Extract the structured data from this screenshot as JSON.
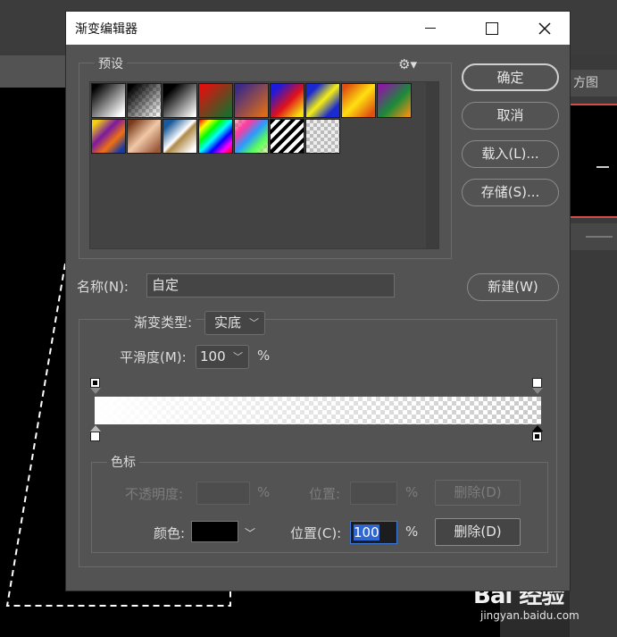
{
  "background": {
    "right_panel_tab": "方图",
    "watermark_logo": "Bai 经验",
    "watermark_url": "jingyan.baidu.com"
  },
  "dialog": {
    "title": "渐变编辑器",
    "presets": {
      "label": "预设",
      "swatches": [
        {
          "name": "black-white",
          "style": "linear-gradient(135deg,#000 10%,#fff 90%)"
        },
        {
          "name": "black-transparent",
          "style": "linear-gradient(135deg,#000 10%,rgba(0,0,0,0) 90%)",
          "checker": true
        },
        {
          "name": "black-white-2",
          "style": "linear-gradient(135deg,#000 20%,#fff 95%)"
        },
        {
          "name": "red-green",
          "style": "linear-gradient(135deg,#e01010 10%,#1b6d2a 90%)"
        },
        {
          "name": "violet-orange",
          "style": "linear-gradient(135deg,#3a2a8a 10%,#d96a1a 90%)"
        },
        {
          "name": "blue-red-yellow",
          "style": "linear-gradient(135deg,#1a1ae0 15%,#e0101a 55%,#f5e010 90%)"
        },
        {
          "name": "blue-yellow-blue",
          "style": "linear-gradient(135deg,#1a2ad0 20%,#f5f010 50%,#1a2ad0 80%)"
        },
        {
          "name": "orange-yellow-orange",
          "style": "linear-gradient(135deg,#e05010 10%,#ffe010 50%,#e05010 90%)"
        },
        {
          "name": "violet-green-orange",
          "style": "linear-gradient(135deg,#8a1aa0 10%,#1a8a3a 55%,#f09010 95%)"
        },
        {
          "name": "yellow-violet-orange-blue",
          "style": "linear-gradient(135deg,#f5d010 10%,#7a1aa0 40%,#f07010 65%,#1a3aa0 90%)"
        },
        {
          "name": "copper",
          "style": "linear-gradient(135deg,#7a3a1a 10%,#f0c8a8 50%,#9a5a3a 90%)"
        },
        {
          "name": "chrome",
          "style": "linear-gradient(135deg,#1a5a9a 15%,#ffffff 48%,#b08a4a 55%,#ffffff 90%)"
        },
        {
          "name": "spectrum",
          "style": "linear-gradient(135deg,#ff0000,#ffff00,#00ff00,#00ffff,#0000ff,#ff00ff,#ff0000)"
        },
        {
          "name": "transparent-rainbow",
          "style": "linear-gradient(135deg,rgba(255,0,0,.2),#ff3aa0,#2a9aff,#5aff5a,rgba(255,255,0,.2))",
          "checker": true
        },
        {
          "name": "transparent-stripes",
          "style": "repeating-linear-gradient(135deg,#000 0 4px,#fff 4px 8px)"
        },
        {
          "name": "transparent",
          "style": "none",
          "checker": true
        }
      ]
    },
    "buttons": {
      "ok": "确定",
      "cancel": "取消",
      "load": "载入(L)...",
      "save": "存储(S)...",
      "new": "新建(W)"
    },
    "name_label": "名称(N):",
    "name_value": "自定",
    "gradient_type_label": "渐变类型:",
    "gradient_type_value": "实底",
    "smoothness_label": "平滑度(M):",
    "smoothness_value": "100",
    "smoothness_unit": "%",
    "stops": {
      "label": "色标",
      "opacity_label": "不透明度:",
      "opacity_value": "",
      "opacity_unit": "%",
      "opacity_location_label": "位置:",
      "opacity_location_value": "",
      "opacity_location_unit": "%",
      "opacity_delete": "删除(D)",
      "color_label": "颜色:",
      "color_value": "#000000",
      "color_location_label": "位置(C):",
      "color_location_value": "100",
      "color_location_unit": "%",
      "color_delete": "删除(D)"
    }
  }
}
